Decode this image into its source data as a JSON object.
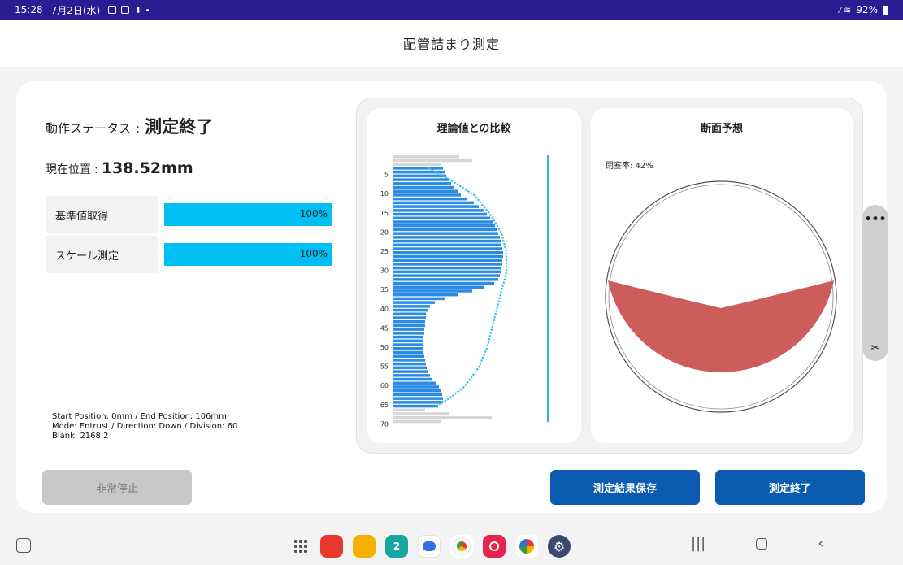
{
  "status_bar": {
    "time": "15:28",
    "date": "7月2日(水)",
    "battery": "92%"
  },
  "header": {
    "title": "配管詰まり測定"
  },
  "status": {
    "label": "動作ステータス",
    "separator": ":",
    "value": "測定終了"
  },
  "position": {
    "label": "現在位置",
    "separator": ":",
    "value": "138.52mm"
  },
  "progress": [
    {
      "label": "基準値取得",
      "value": 100,
      "text": "100%"
    },
    {
      "label": "スケール測定",
      "value": 100,
      "text": "100%"
    }
  ],
  "info": {
    "line1": "Start Position: 0mm / End Position: 106mm",
    "line2": "Mode: Entrust / Direction: Down / Division: 60",
    "line3": "Blank: 2168.2"
  },
  "comparison_panel": {
    "title": "理論値との比較"
  },
  "cross_section_panel": {
    "title": "断面予想",
    "blockage_text": "閉塞率: 42%"
  },
  "chart_data": {
    "type": "bar",
    "orientation": "horizontal",
    "y_ticks": [
      "5",
      "10",
      "15",
      "20",
      "25",
      "30",
      "35",
      "40",
      "45",
      "50",
      "55",
      "60",
      "65",
      "70"
    ],
    "ylim": [
      0,
      70
    ],
    "blue_rows": [
      [
        3,
        62
      ],
      [
        4,
        65
      ],
      [
        5,
        66
      ],
      [
        6,
        69
      ],
      [
        7,
        72
      ],
      [
        8,
        76
      ],
      [
        9,
        80
      ],
      [
        10,
        84
      ],
      [
        11,
        92
      ],
      [
        12,
        100
      ],
      [
        13,
        106
      ],
      [
        14,
        112
      ],
      [
        15,
        116
      ],
      [
        16,
        120
      ],
      [
        17,
        124
      ],
      [
        18,
        126
      ],
      [
        19,
        128
      ],
      [
        20,
        130
      ],
      [
        21,
        132
      ],
      [
        22,
        134
      ],
      [
        23,
        134
      ],
      [
        24,
        135
      ],
      [
        25,
        136
      ],
      [
        26,
        136
      ],
      [
        27,
        135
      ],
      [
        28,
        135
      ],
      [
        29,
        134
      ],
      [
        30,
        133
      ],
      [
        31,
        132
      ],
      [
        32,
        130
      ],
      [
        33,
        125
      ],
      [
        34,
        112
      ],
      [
        35,
        98
      ],
      [
        36,
        80
      ],
      [
        37,
        64
      ],
      [
        38,
        52
      ],
      [
        39,
        46
      ],
      [
        40,
        43
      ],
      [
        41,
        41
      ],
      [
        42,
        41
      ],
      [
        43,
        40
      ],
      [
        44,
        40
      ],
      [
        45,
        39
      ],
      [
        46,
        39
      ],
      [
        47,
        38
      ],
      [
        48,
        38
      ],
      [
        49,
        37
      ],
      [
        50,
        38
      ],
      [
        51,
        38
      ],
      [
        52,
        39
      ],
      [
        53,
        40
      ],
      [
        54,
        41
      ],
      [
        55,
        42
      ],
      [
        56,
        44
      ],
      [
        57,
        46
      ],
      [
        58,
        49
      ],
      [
        59,
        53
      ],
      [
        60,
        57
      ],
      [
        61,
        60
      ],
      [
        62,
        61
      ],
      [
        63,
        62
      ],
      [
        64,
        62
      ],
      [
        65,
        56
      ]
    ],
    "gray_rows": [
      [
        0,
        82
      ],
      [
        1,
        98
      ],
      [
        2,
        60
      ],
      [
        66,
        40
      ],
      [
        67,
        70
      ],
      [
        68,
        122
      ],
      [
        69,
        60
      ]
    ],
    "theory_curve": [
      [
        3,
        44
      ],
      [
        6,
        70
      ],
      [
        10,
        100
      ],
      [
        15,
        120
      ],
      [
        20,
        134
      ],
      [
        25,
        140
      ],
      [
        30,
        140
      ],
      [
        32,
        138
      ],
      [
        35,
        134
      ],
      [
        40,
        128
      ],
      [
        45,
        122
      ],
      [
        50,
        116
      ],
      [
        55,
        106
      ],
      [
        60,
        88
      ],
      [
        63,
        70
      ],
      [
        65,
        54
      ]
    ],
    "series": [
      {
        "name": "measured",
        "color": "#2b8ce6"
      },
      {
        "name": "theory",
        "color": "#3ac4e6"
      },
      {
        "name": "outside",
        "color": "#d6d6d6"
      }
    ],
    "blockage_percent": 42
  },
  "buttons": {
    "stop": "非常停止",
    "save": "測定結果保存",
    "end": "測定終了"
  },
  "side_handle": {
    "dots": "•••",
    "cut": "✂"
  },
  "nav": {
    "apps": [
      "sticky-note",
      "folder",
      "calendar",
      "chat",
      "chrome",
      "camera",
      "photos",
      "settings"
    ],
    "calendar_day": "2"
  }
}
